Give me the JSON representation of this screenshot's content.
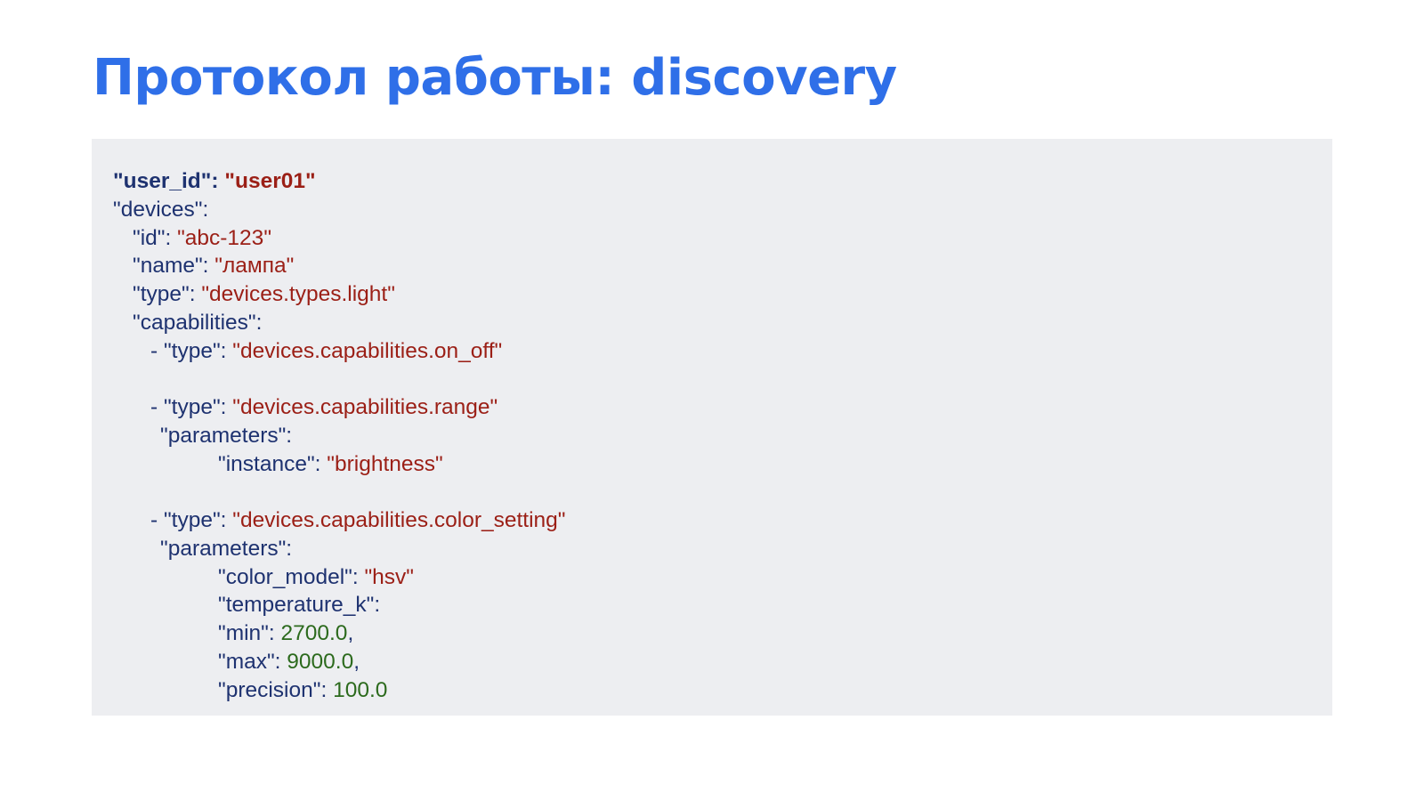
{
  "slide": {
    "title": "Протокол работы: discovery"
  },
  "code_lines": [
    {
      "indent": 0,
      "bold": true,
      "tokens": [
        {
          "type": "key",
          "text": "\"user_id\": "
        },
        {
          "type": "string",
          "text": "\"user01\""
        }
      ]
    },
    {
      "indent": 0,
      "tokens": [
        {
          "type": "key",
          "text": "\"devices\":"
        }
      ]
    },
    {
      "indent": 1,
      "tokens": [
        {
          "type": "key",
          "text": "\"id\": "
        },
        {
          "type": "string",
          "text": "\"abc-123\""
        }
      ]
    },
    {
      "indent": 1,
      "tokens": [
        {
          "type": "key",
          "text": "\"name\": "
        },
        {
          "type": "string",
          "text": "\"лампа\""
        }
      ]
    },
    {
      "indent": 1,
      "tokens": [
        {
          "type": "key",
          "text": "\"type\": "
        },
        {
          "type": "string",
          "text": "\"devices.types.light\""
        }
      ]
    },
    {
      "indent": 1,
      "tokens": [
        {
          "type": "key",
          "text": "\"capabilities\":"
        }
      ]
    },
    {
      "indent": 2,
      "tokens": [
        {
          "type": "key",
          "text": "- \"type\": "
        },
        {
          "type": "string",
          "text": "\"devices.capabilities.on_off\""
        }
      ]
    },
    {
      "indent": 0,
      "tokens": []
    },
    {
      "indent": 2,
      "tokens": [
        {
          "type": "key",
          "text": "- \"type\": "
        },
        {
          "type": "string",
          "text": "\"devices.capabilities.range\""
        }
      ]
    },
    {
      "indent": 3,
      "tokens": [
        {
          "type": "key",
          "text": "\"parameters\":"
        }
      ]
    },
    {
      "indent": 4,
      "tokens": [
        {
          "type": "key",
          "text": "\"instance\": "
        },
        {
          "type": "string",
          "text": "\"brightness\""
        }
      ]
    },
    {
      "indent": 0,
      "tokens": []
    },
    {
      "indent": 2,
      "tokens": [
        {
          "type": "key",
          "text": "- \"type\": "
        },
        {
          "type": "string",
          "text": "\"devices.capabilities.color_setting\""
        }
      ]
    },
    {
      "indent": 3,
      "tokens": [
        {
          "type": "key",
          "text": "\"parameters\":"
        }
      ]
    },
    {
      "indent": 4,
      "tokens": [
        {
          "type": "key",
          "text": "\"color_model\": "
        },
        {
          "type": "string",
          "text": "\"hsv\""
        }
      ]
    },
    {
      "indent": 4,
      "tokens": [
        {
          "type": "key",
          "text": "\"temperature_k\":"
        }
      ]
    },
    {
      "indent": 4,
      "tokens": [
        {
          "type": "key",
          "text": "\"min\": "
        },
        {
          "type": "number",
          "text": "2700.0"
        },
        {
          "type": "key",
          "text": ","
        }
      ]
    },
    {
      "indent": 4,
      "tokens": [
        {
          "type": "key",
          "text": "\"max\": "
        },
        {
          "type": "number",
          "text": "9000.0"
        },
        {
          "type": "key",
          "text": ","
        }
      ]
    },
    {
      "indent": 4,
      "tokens": [
        {
          "type": "key",
          "text": "\"precision\": "
        },
        {
          "type": "number",
          "text": "100.0"
        }
      ]
    }
  ],
  "colors": {
    "title": "#2f6fe8",
    "code_background": "#edeef1",
    "key": "#1e3270",
    "string": "#9b1f16",
    "number": "#2c6a1d"
  }
}
